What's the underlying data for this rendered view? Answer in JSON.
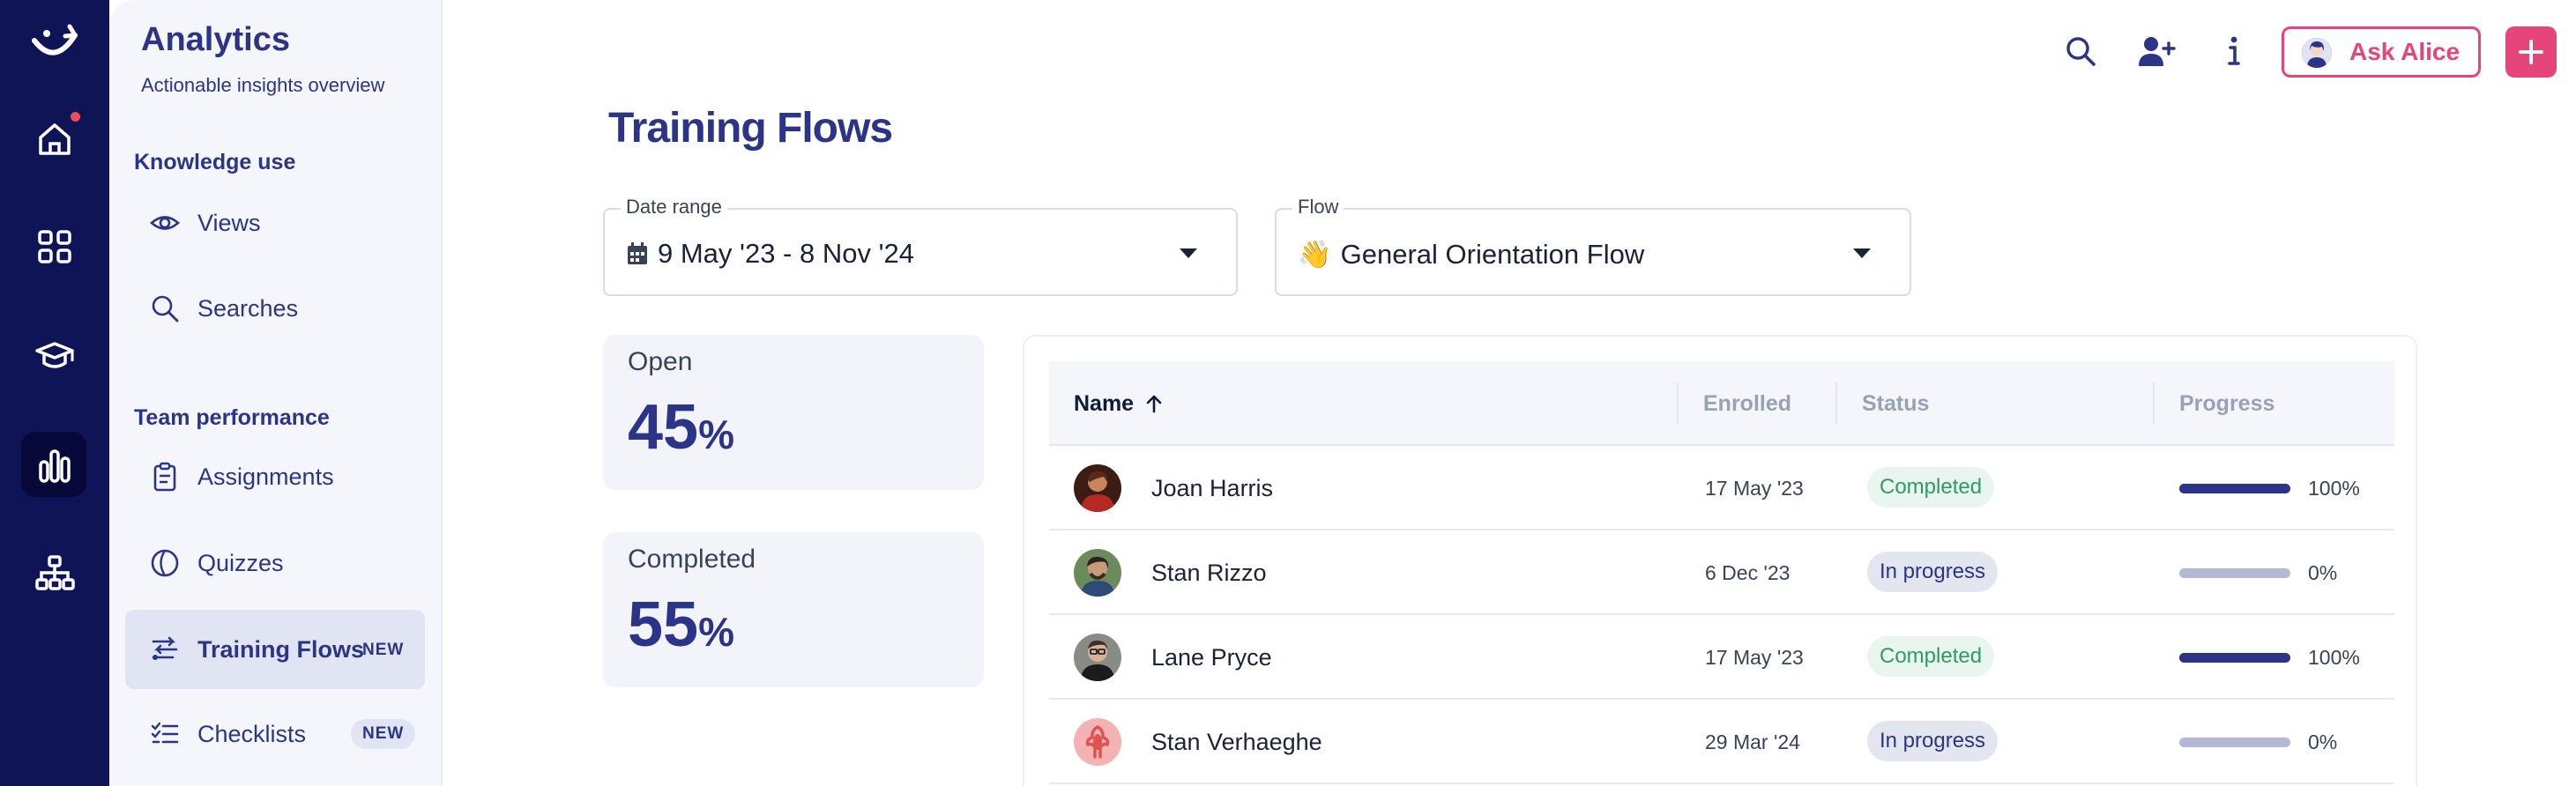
{
  "app": {
    "section_title": "Analytics",
    "section_subtitle": "Actionable insights overview"
  },
  "rail": {
    "items": [
      {
        "icon": "logo-icon"
      },
      {
        "icon": "home-icon",
        "notification": true
      },
      {
        "icon": "apps-grid-icon"
      },
      {
        "icon": "graduation-cap-icon"
      },
      {
        "icon": "bar-chart-icon",
        "active": true
      },
      {
        "icon": "org-chart-icon"
      }
    ]
  },
  "sidebar": {
    "knowledge_heading": "Knowledge use",
    "team_heading": "Team performance",
    "items": [
      {
        "label": "Views",
        "icon": "eye-icon"
      },
      {
        "label": "Searches",
        "icon": "search-icon"
      },
      {
        "label": "Assignments",
        "icon": "clipboard-icon"
      },
      {
        "label": "Quizzes",
        "icon": "quiz-icon"
      },
      {
        "label": "Training Flows",
        "icon": "flow-icon",
        "badge": "NEW",
        "active": true
      },
      {
        "label": "Checklists",
        "icon": "checklist-icon",
        "badge": "NEW"
      }
    ]
  },
  "topbar": {
    "ask_label": "Ask Alice",
    "accent": "#e6457a"
  },
  "main": {
    "title": "Training Flows",
    "date_range": {
      "label": "Date range",
      "value": "9 May '23 - 8 Nov '24"
    },
    "flow": {
      "label": "Flow",
      "emoji": "👋",
      "value": "General Orientation Flow"
    },
    "stats": [
      {
        "label": "Open",
        "value": "45",
        "unit": "%"
      },
      {
        "label": "Completed",
        "value": "55",
        "unit": "%"
      }
    ],
    "table": {
      "columns": [
        "Name",
        "Enrolled",
        "Status",
        "Progress"
      ],
      "rows": [
        {
          "name": "Joan Harris",
          "enrolled": "17 May '23",
          "status": "Completed",
          "progress_label": "100%",
          "progress": 1.0
        },
        {
          "name": "Stan Rizzo",
          "enrolled": "6 Dec '23",
          "status": "In progress",
          "progress_label": "0%",
          "progress": 0.0
        },
        {
          "name": "Lane Pryce",
          "enrolled": "17 May '23",
          "status": "Completed",
          "progress_label": "100%",
          "progress": 1.0
        },
        {
          "name": "Stan Verhaeghe",
          "enrolled": "29 Mar '24",
          "status": "In progress",
          "progress_label": "0%",
          "progress": 0.0
        }
      ]
    }
  }
}
